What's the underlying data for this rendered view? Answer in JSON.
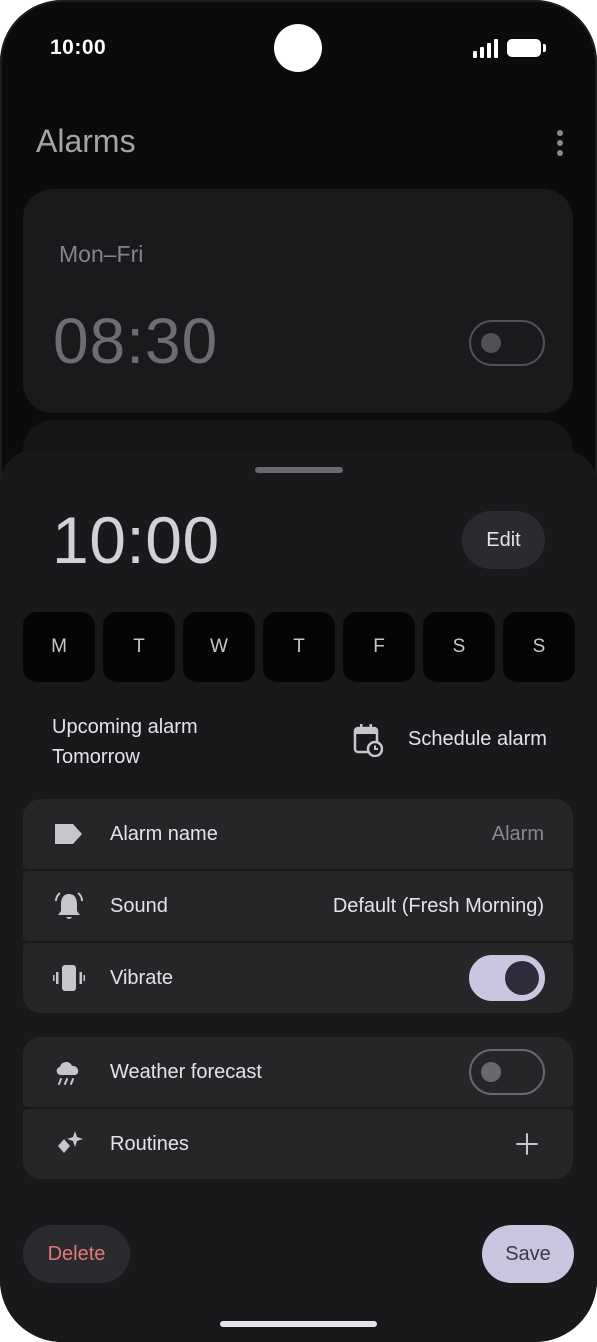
{
  "status_bar": {
    "time": "10:00"
  },
  "app": {
    "title": "Alarms"
  },
  "alarm_card": {
    "days": "Mon–Fri",
    "time": "08:30",
    "enabled": false
  },
  "sheet": {
    "time": "10:00",
    "edit_label": "Edit",
    "days": [
      {
        "label": "M"
      },
      {
        "label": "T"
      },
      {
        "label": "W"
      },
      {
        "label": "T"
      },
      {
        "label": "F"
      },
      {
        "label": "S"
      },
      {
        "label": "S"
      }
    ],
    "upcoming": {
      "line1": "Upcoming alarm",
      "line2": "Tomorrow"
    },
    "schedule_label": "Schedule alarm",
    "rows": {
      "alarm_name": {
        "label": "Alarm name",
        "value": "Alarm",
        "icon": "label-icon"
      },
      "sound": {
        "label": "Sound",
        "value": "Default (Fresh Morning)",
        "icon": "bell-icon"
      },
      "vibrate": {
        "label": "Vibrate",
        "enabled": true,
        "icon": "vibrate-icon"
      },
      "weather": {
        "label": "Weather forecast",
        "enabled": false,
        "icon": "weather-icon"
      },
      "routines": {
        "label": "Routines",
        "icon": "sparkle-icon"
      }
    },
    "delete_label": "Delete",
    "save_label": "Save"
  },
  "colors": {
    "accent": "#c9c6df",
    "danger": "#e0797a",
    "surface": "#262628"
  }
}
